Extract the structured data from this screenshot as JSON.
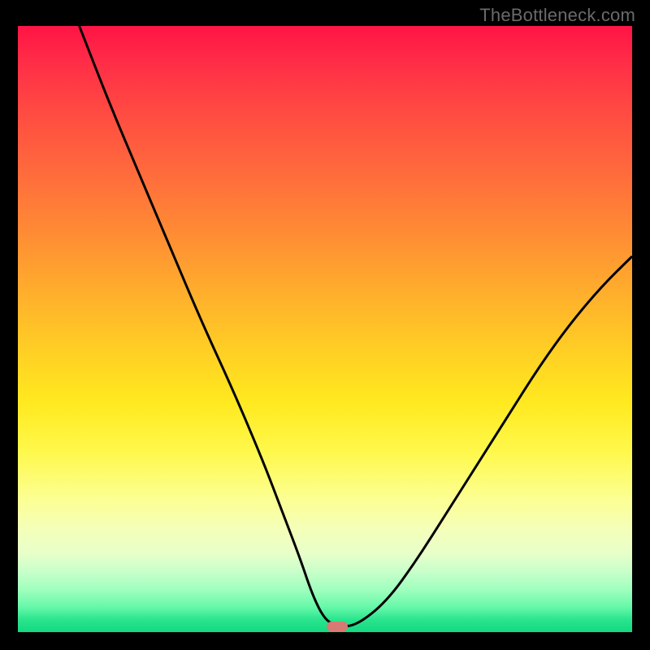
{
  "watermark": "TheBottleneck.com",
  "colors": {
    "curve_stroke": "#000000",
    "marker_fill": "#d77a73",
    "background": "#000000"
  },
  "chart_data": {
    "type": "line",
    "title": "",
    "xlabel": "",
    "ylabel": "",
    "xlim": [
      0,
      100
    ],
    "ylim": [
      0,
      100
    ],
    "grid": false,
    "legend": false,
    "series": [
      {
        "name": "bottleneck-curve",
        "x": [
          10,
          15,
          20,
          25,
          30,
          35,
          40,
          43,
          46,
          48,
          50,
          52,
          55,
          60,
          65,
          70,
          75,
          80,
          85,
          90,
          95,
          100
        ],
        "y": [
          100,
          87,
          75,
          63,
          51,
          40,
          28,
          20,
          12,
          6,
          2,
          1,
          1,
          5,
          12,
          20,
          28,
          36,
          44,
          51,
          57,
          62
        ]
      }
    ],
    "annotations": [
      {
        "name": "optimal-marker",
        "x": 52,
        "y": 1
      }
    ],
    "gradient_stops": [
      {
        "pct": 0,
        "color": "#ff1446"
      },
      {
        "pct": 14,
        "color": "#ff4a42"
      },
      {
        "pct": 34,
        "color": "#ff8b34"
      },
      {
        "pct": 54,
        "color": "#ffd024"
      },
      {
        "pct": 70,
        "color": "#fff84a"
      },
      {
        "pct": 87,
        "color": "#e8ffc9"
      },
      {
        "pct": 100,
        "color": "#14d880"
      }
    ]
  }
}
